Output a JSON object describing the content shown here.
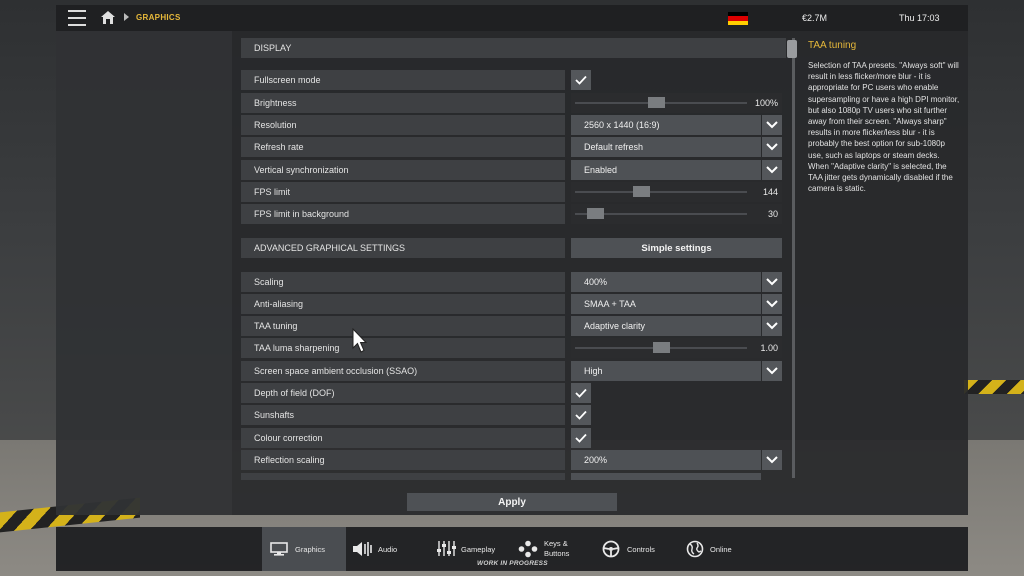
{
  "topbar": {
    "breadcrumb": "GRAPHICS",
    "money": "€2.7M",
    "clock": "Thu 17:03",
    "flag_colors": [
      "#000000",
      "#dd0000",
      "#ffce00"
    ]
  },
  "display_section": {
    "header": "DISPLAY",
    "rows": [
      {
        "label": "Fullscreen mode",
        "type": "checkbox",
        "checked": true
      },
      {
        "label": "Brightness",
        "type": "slider",
        "value": "100%",
        "level": 0.47
      },
      {
        "label": "Resolution",
        "type": "dropdown",
        "value": "2560 x 1440 (16:9)"
      },
      {
        "label": "Refresh rate",
        "type": "dropdown",
        "value": "Default refresh"
      },
      {
        "label": "Vertical synchronization",
        "type": "dropdown",
        "value": "Enabled"
      },
      {
        "label": "FPS limit",
        "type": "slider",
        "value": "144",
        "level": 0.38
      },
      {
        "label": "FPS limit in background",
        "type": "slider",
        "value": "30",
        "level": 0.1
      }
    ]
  },
  "advanced_section": {
    "header": "ADVANCED GRAPHICAL SETTINGS",
    "toggle_button": "Simple settings",
    "rows": [
      {
        "label": "Scaling",
        "type": "dropdown",
        "value": "400%"
      },
      {
        "label": "Anti-aliasing",
        "type": "dropdown",
        "value": "SMAA + TAA"
      },
      {
        "label": "TAA tuning",
        "type": "dropdown",
        "value": "Adaptive clarity"
      },
      {
        "label": "TAA luma sharpening",
        "type": "slider",
        "value": "1.00",
        "level": 0.5
      },
      {
        "label": "Screen space ambient occlusion (SSAO)",
        "type": "dropdown",
        "value": "High"
      },
      {
        "label": "Depth of field (DOF)",
        "type": "checkbox",
        "checked": true
      },
      {
        "label": "Sunshafts",
        "type": "checkbox",
        "checked": true
      },
      {
        "label": "Colour correction",
        "type": "checkbox",
        "checked": true
      },
      {
        "label": "Reflection scaling",
        "type": "dropdown",
        "value": "200%"
      }
    ]
  },
  "help": {
    "title": "TAA tuning",
    "text": "Selection of TAA presets. \"Always soft\" will result in less flicker/more blur - it is appropriate for PC users who enable supersampling or have a high DPI monitor, but also 1080p TV users who sit further away from their screen. \"Always sharp\" results in more flicker/less blur - it is probably the best option for sub-1080p use, such as laptops or steam decks. When \"Adaptive clarity\" is selected, the TAA jitter gets dynamically disabled if the camera is static."
  },
  "apply_label": "Apply",
  "bottom_tabs": [
    {
      "label": "Graphics",
      "icon": "monitor-icon",
      "active": true
    },
    {
      "label": "Audio",
      "icon": "speaker-icon",
      "active": false
    },
    {
      "label": "Gameplay",
      "icon": "sliders-icon",
      "active": false
    },
    {
      "label": "Keys & Buttons",
      "line1": "Keys &",
      "line2": "Buttons",
      "icon": "gamepad-buttons-icon",
      "active": false
    },
    {
      "label": "Controls",
      "icon": "steering-wheel-icon",
      "active": false
    },
    {
      "label": "Online",
      "icon": "globe-icon",
      "active": false
    }
  ],
  "wip_label": "WORK IN PROGRESS",
  "colors": {
    "accent": "#e6b83a"
  }
}
